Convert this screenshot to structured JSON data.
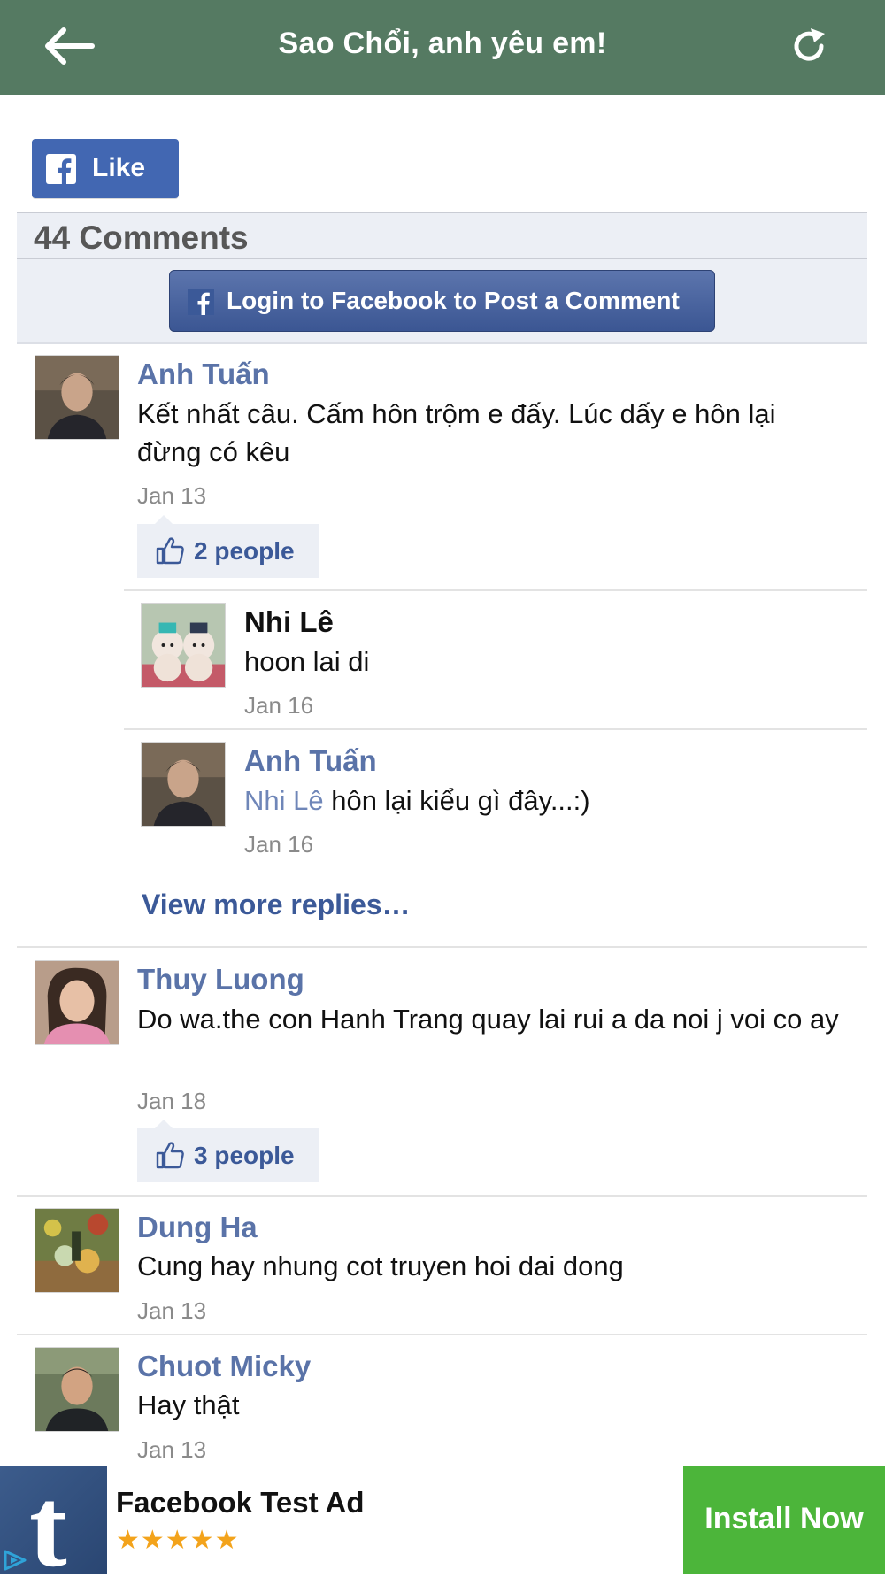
{
  "header": {
    "title": "Sao Chổi, anh yêu em!",
    "bg_color": "#557a62",
    "back_icon": "arrow-left-icon",
    "refresh_icon": "refresh-icon"
  },
  "like_button": {
    "label": "Like",
    "color": "#4267b2"
  },
  "comments_count": "44 Comments",
  "login_button": {
    "label": "Login to Facebook to Post a Comment"
  },
  "comments": [
    {
      "name": "Anh Tuấn",
      "text": "Kết nhất câu. Cấm hôn trộm e đấy. Lúc dấy e hôn lại đừng có kêu",
      "date": "Jan 13",
      "likes": "2 people",
      "replies": [
        {
          "name": "Nhi Lê",
          "text": "hoon lai di",
          "date": "Jan 16"
        },
        {
          "name": "Anh Tuấn",
          "tag": "Nhi Lê",
          "text": " hôn lại kiểu gì đây...:)",
          "date": "Jan 16"
        }
      ],
      "more_replies": "View more replies…"
    },
    {
      "name": "Thuy Luong",
      "text": "Do wa.the con Hanh Trang quay lai rui a da noi j voi co ay",
      "date": "Jan 18",
      "likes": "3 people"
    },
    {
      "name": "Dung Ha",
      "text": "Cung hay nhung cot truyen hoi dai dong",
      "date": "Jan 13"
    },
    {
      "name": "Chuot Micky",
      "text": "Hay thật",
      "date": "Jan 13"
    }
  ],
  "ad": {
    "app_letter": "t",
    "name": "Facebook Test Ad",
    "stars": "★★★★★",
    "install_label": "Install Now",
    "install_color": "#4cb53a"
  }
}
